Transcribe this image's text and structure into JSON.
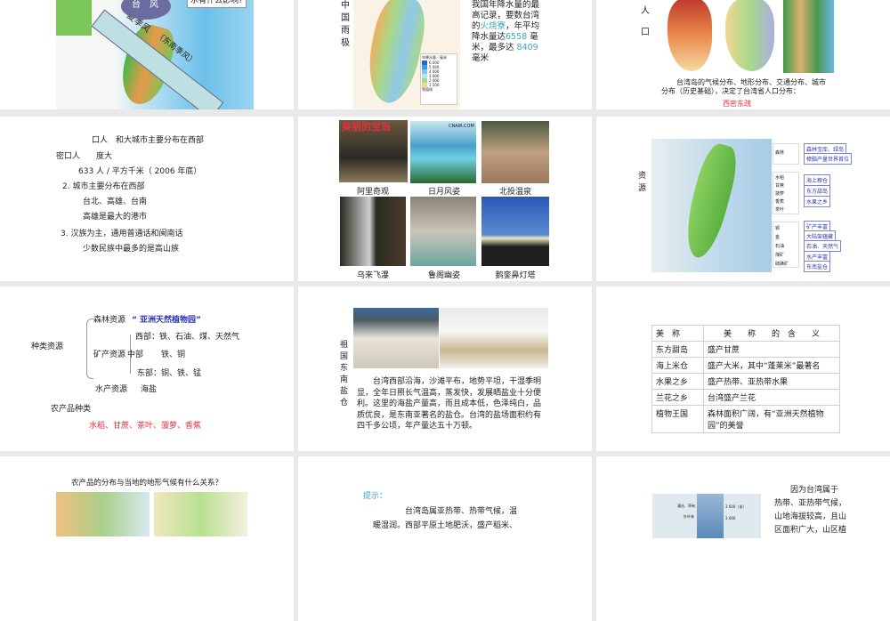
{
  "slides": [
    {
      "callout": "水有什么影响?",
      "typhoon": "台　风",
      "monsoon": "夏季风",
      "monsoon_sub": "（东南季风）"
    },
    {
      "side_title": "中国雨极",
      "text_a": "我国年降水量的最高记录，要数台湾的",
      "place": "火烧寮",
      "text_b": "，年平均降水量达",
      "avg": "6558",
      "text_c": " 毫米，最多达 ",
      "max": "8409",
      "text_d": "毫米",
      "legend_title": "年降水量／毫米",
      "legend_items": [
        "6 000",
        "5 000",
        "4 000",
        "3 000",
        "2 000",
        "1 500"
      ],
      "legend_line": "等值线"
    },
    {
      "side_a": "人",
      "side_b": "口",
      "caption_1": "台湾岛的气候分布、地形分布、交通分布、城市",
      "caption_2": "分布（历史基础），决定了台湾省人口分布：",
      "highlight": "西密东疏"
    },
    {
      "lines": [
        "口人　和大城市主要分布在西部",
        "密口人　　度大",
        "633 人 / 平方千米（ 2006 年底）",
        "2. 城市主要分布在西部",
        "台北、高雄、台南",
        "高雄是最大的港市",
        "3. 汉族为主，通用普通话和闽南话",
        "少数民族中最多的是高山族"
      ]
    },
    {
      "banner": "美丽的宝岛",
      "watermark": "CNAIR.COM",
      "photos": [
        "阿里奇观",
        "日月风姿",
        "北投温泉",
        "乌来飞瀑",
        "鲁阁幽姿",
        "鹅銮鼻灯塔"
      ]
    },
    {
      "side_title": "资　源",
      "legend_groups": [
        [
          "森林"
        ],
        [
          "水稻",
          "甘蔗",
          "菠萝",
          "香蕉",
          "茶叶"
        ],
        [
          "铜",
          "金",
          "石油",
          "煤矿",
          "硫磺矿"
        ]
      ],
      "labels": [
        "森林宝库、绿岛",
        "樟脑产量世界首位",
        "海上粮仓",
        "东方甜岛",
        "水果之乡",
        "矿产丰富",
        "大陆架蕴藏",
        "石油、天然气",
        "水产丰富",
        "东南盐仓"
      ]
    },
    {
      "root": "种类资源",
      "forest": "森林资源",
      "forest_note": "“ 亚洲天然植物园”",
      "mineral": "矿产资源",
      "west": "西部：铁、石油、煤、天然气",
      "middle": "中部",
      "middle_val": "铁、铜",
      "east": "东部：铜、铁、锰",
      "water": "水产资源",
      "water_val": "海盐",
      "agri": "农产品种类",
      "agri_val": "水稻、甘蔗、茶叶、菠萝、香蕉"
    },
    {
      "side_title": "祖国东南盐仓",
      "body": "台湾西部沿海，沙滩平布，地势平坦，干湿季明显，全年日照长气温高，蒸发快，发展晒盐业十分便利。这里的海盐产量高，而且成本低，色泽纯白，品质优良，是东南亚著名的盐仓。台湾的盐场面积约有四千多公顷，年产量达五十万顿。"
    },
    {
      "headers": [
        "美　称",
        "美　　称　　的　含　　义"
      ],
      "rows": [
        [
          "东方甜岛",
          "盛产甘蔗"
        ],
        [
          "海上米仓",
          "盛产大米，其中“蓬莱米”最著名"
        ],
        [
          "水果之乡",
          "盛产热带、亚热带水果"
        ],
        [
          "兰花之乡",
          "台湾盛产兰花"
        ],
        [
          "植物王国",
          "森林面积广阔，有“亚洲天然植物园”的美誉"
        ]
      ]
    },
    {
      "title": "农产品的分布与当地的地形气候有什么关系？"
    },
    {
      "hint": "提示：",
      "body_1": "台湾岛属亚热带、热带气候，温",
      "body_2": "暖湿润。西部平原土地肥沃，盛产稻米、"
    },
    {
      "body": [
        "因为台湾属于",
        "热带、亚热带气候，",
        "山地海拔较高，且山",
        "区面积广大，山区植"
      ],
      "diagram_labels": [
        "灌丛、草甸",
        "针叶林"
      ],
      "diagram_ticks": [
        "3 600（米）",
        "3 000"
      ]
    }
  ]
}
